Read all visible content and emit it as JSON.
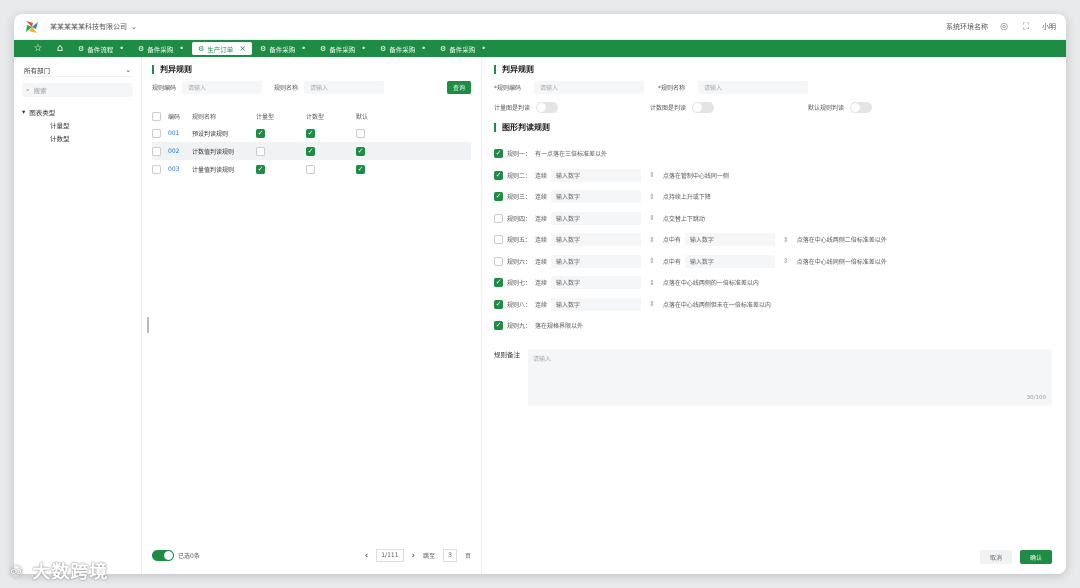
{
  "topbar": {
    "company": "某某某某某科技有限公司",
    "env_name": "系统环境名称",
    "user": "小明"
  },
  "tabs": [
    {
      "label": "备件流程"
    },
    {
      "label": "备件采购"
    },
    {
      "label": "生产订单"
    },
    {
      "label": "备件采购"
    },
    {
      "label": "备件采购"
    },
    {
      "label": "备件采购"
    },
    {
      "label": "备件采购"
    }
  ],
  "left": {
    "dept": "所有部门",
    "search_placeholder": "搜索",
    "tree_root": "图表类型",
    "tree_children": [
      "计量型",
      "计数型"
    ]
  },
  "mid": {
    "title": "判异规则",
    "filter_code_label": "规则编码",
    "filter_code_placeholder": "请输入",
    "filter_name_label": "规则名称",
    "filter_name_placeholder": "请输入",
    "query_btn": "查询",
    "columns": [
      "编码",
      "规则名称",
      "计量型",
      "计数型",
      "默认"
    ],
    "rows": [
      {
        "code": "001",
        "name": "预设判读规则",
        "c1": true,
        "c2": true,
        "c3": false
      },
      {
        "code": "002",
        "name": "计数值判读规则",
        "c1": false,
        "c2": true,
        "c3": true
      },
      {
        "code": "003",
        "name": "计量值判读规则",
        "c1": true,
        "c2": false,
        "c3": true
      }
    ],
    "selected_label": "已选0条",
    "page": "1/111",
    "jump_label": "跳至",
    "jump_value": "3",
    "page_unit": "页"
  },
  "right": {
    "title": "判异规则",
    "code_label": "*规则编码",
    "code_placeholder": "请输入",
    "name_label": "*规则名称",
    "name_placeholder": "请输入",
    "sw1": "计量图是判读",
    "sw2": "计数图是判读",
    "sw3": "默认规则判读",
    "sub_title": "图形判读规则",
    "rules": [
      {
        "on": true,
        "label": "规则一：",
        "pre": "有一点落在三倍标准差以外",
        "inp1": "",
        "mid": "",
        "inp2": "",
        "post": ""
      },
      {
        "on": true,
        "label": "规则二：",
        "pre": "连续",
        "inp1": "输入数字",
        "mid": "点落在管制中心线同一侧",
        "inp2": "",
        "post": ""
      },
      {
        "on": true,
        "label": "规则三：",
        "pre": "连续",
        "inp1": "输入数字",
        "mid": "点持续上升或下降",
        "inp2": "",
        "post": ""
      },
      {
        "on": false,
        "label": "规则四：",
        "pre": "连续",
        "inp1": "输入数字",
        "mid": "点交替上下跳动",
        "inp2": "",
        "post": ""
      },
      {
        "on": false,
        "label": "规则五：",
        "pre": "连续",
        "inp1": "输入数字",
        "mid": "点中有",
        "inp2": "输入数字",
        "post": "点落在中心线两侧二倍标准差以外"
      },
      {
        "on": false,
        "label": "规则六：",
        "pre": "连续",
        "inp1": "输入数字",
        "mid": "点中有",
        "inp2": "输入数字",
        "post": "点落在中心线同侧一倍标准差以外"
      },
      {
        "on": true,
        "label": "规则七：",
        "pre": "连续",
        "inp1": "输入数字",
        "mid": "点落在中心线两侧的一倍标准差以内",
        "inp2": "",
        "post": ""
      },
      {
        "on": true,
        "label": "规则八：",
        "pre": "连续",
        "inp1": "输入数字",
        "mid": "点落在中心线两侧但未在一倍标准差以内",
        "inp2": "",
        "post": ""
      },
      {
        "on": true,
        "label": "规则九：",
        "pre": "落在规格界限以外",
        "inp1": "",
        "mid": "",
        "inp2": "",
        "post": ""
      }
    ],
    "remark_label": "规则备注",
    "remark_placeholder": "请输入",
    "remark_count": "30/100",
    "cancel": "取消",
    "confirm": "确认"
  },
  "watermark": "大数跨境",
  "colors": {
    "brand": "#1f8c45",
    "link": "#1f6fd1"
  }
}
